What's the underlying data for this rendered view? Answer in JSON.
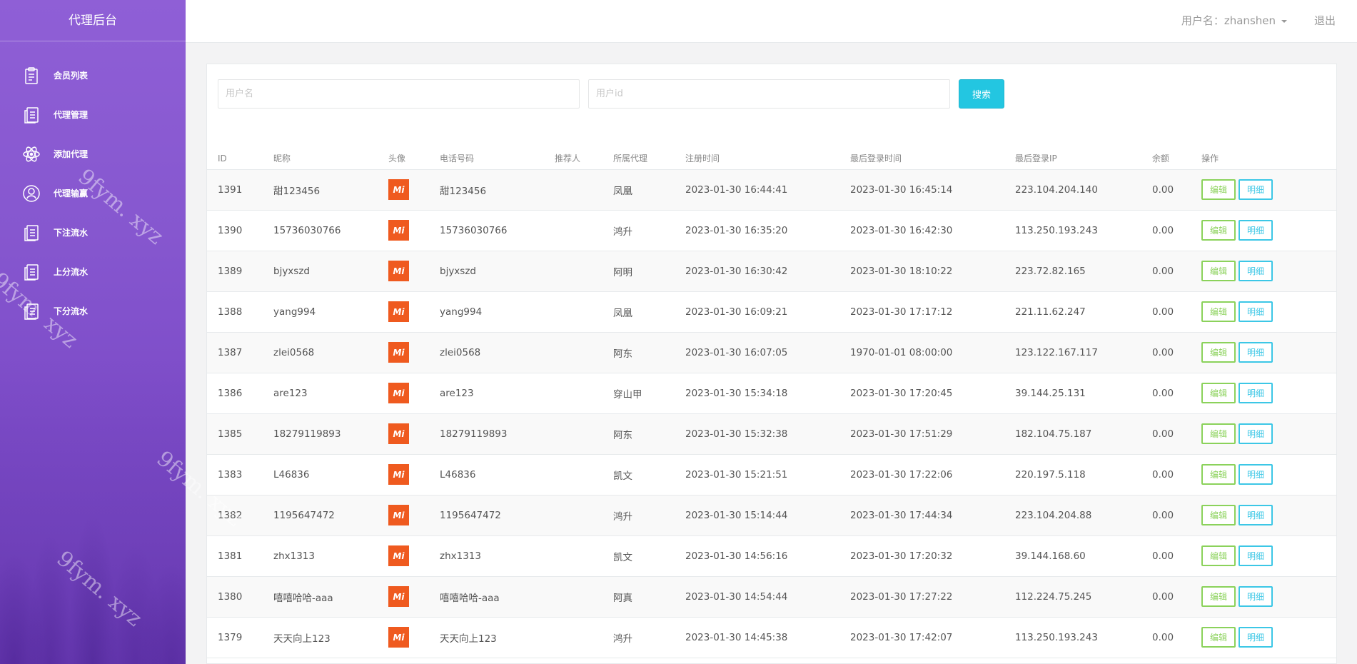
{
  "app": {
    "title": "代理后台"
  },
  "sidebar": {
    "items": [
      {
        "label": "会员列表",
        "icon": "clipboard-icon"
      },
      {
        "label": "代理管理",
        "icon": "document-icon"
      },
      {
        "label": "添加代理",
        "icon": "atom-icon"
      },
      {
        "label": "代理输赢",
        "icon": "user-circle-icon"
      },
      {
        "label": "下注流水",
        "icon": "document-icon"
      },
      {
        "label": "上分流水",
        "icon": "document-icon"
      },
      {
        "label": "下分流水",
        "icon": "document-icon"
      }
    ]
  },
  "topbar": {
    "user_label": "用户名：zhanshen",
    "logout_label": "退出"
  },
  "search": {
    "username_placeholder": "用户名",
    "userid_placeholder": "用户id",
    "button_label": "搜索"
  },
  "table": {
    "columns": [
      "ID",
      "昵称",
      "头像",
      "电话号码",
      "推荐人",
      "所属代理",
      "注册时间",
      "最后登录时间",
      "最后登录IP",
      "余额",
      "操作"
    ],
    "edit_label": "编辑",
    "detail_label": "明细",
    "avatar_text": "Mi",
    "rows": [
      {
        "id": "1391",
        "nickname": "甜123456",
        "phone": "甜123456",
        "referrer": "",
        "agent": "凤凰",
        "register": "2023-01-30 16:44:41",
        "last_login": "2023-01-30 16:45:14",
        "ip": "223.104.204.140",
        "balance": "0.00"
      },
      {
        "id": "1390",
        "nickname": "15736030766",
        "phone": "15736030766",
        "referrer": "",
        "agent": "鸿升",
        "register": "2023-01-30 16:35:20",
        "last_login": "2023-01-30 16:42:30",
        "ip": "113.250.193.243",
        "balance": "0.00"
      },
      {
        "id": "1389",
        "nickname": "bjyxszd",
        "phone": "bjyxszd",
        "referrer": "",
        "agent": "阿明",
        "register": "2023-01-30 16:30:42",
        "last_login": "2023-01-30 18:10:22",
        "ip": "223.72.82.165",
        "balance": "0.00"
      },
      {
        "id": "1388",
        "nickname": "yang994",
        "phone": "yang994",
        "referrer": "",
        "agent": "凤凰",
        "register": "2023-01-30 16:09:21",
        "last_login": "2023-01-30 17:17:12",
        "ip": "221.11.62.247",
        "balance": "0.00"
      },
      {
        "id": "1387",
        "nickname": "zlei0568",
        "phone": "zlei0568",
        "referrer": "",
        "agent": "阿东",
        "register": "2023-01-30 16:07:05",
        "last_login": "1970-01-01 08:00:00",
        "ip": "123.122.167.117",
        "balance": "0.00"
      },
      {
        "id": "1386",
        "nickname": "are123",
        "phone": "are123",
        "referrer": "",
        "agent": "穿山甲",
        "register": "2023-01-30 15:34:18",
        "last_login": "2023-01-30 17:20:45",
        "ip": "39.144.25.131",
        "balance": "0.00"
      },
      {
        "id": "1385",
        "nickname": "18279119893",
        "phone": "18279119893",
        "referrer": "",
        "agent": "阿东",
        "register": "2023-01-30 15:32:38",
        "last_login": "2023-01-30 17:51:29",
        "ip": "182.104.75.187",
        "balance": "0.00"
      },
      {
        "id": "1383",
        "nickname": "L46836",
        "phone": "L46836",
        "referrer": "",
        "agent": "凯文",
        "register": "2023-01-30 15:21:51",
        "last_login": "2023-01-30 17:22:06",
        "ip": "220.197.5.118",
        "balance": "0.00"
      },
      {
        "id": "1382",
        "nickname": "1195647472",
        "phone": "1195647472",
        "referrer": "",
        "agent": "鸿升",
        "register": "2023-01-30 15:14:44",
        "last_login": "2023-01-30 17:44:34",
        "ip": "223.104.204.88",
        "balance": "0.00"
      },
      {
        "id": "1381",
        "nickname": "zhx1313",
        "phone": "zhx1313",
        "referrer": "",
        "agent": "凯文",
        "register": "2023-01-30 14:56:16",
        "last_login": "2023-01-30 17:20:32",
        "ip": "39.144.168.60",
        "balance": "0.00"
      },
      {
        "id": "1380",
        "nickname": "嘻嘻哈哈-aaa",
        "phone": "嘻嘻哈哈-aaa",
        "referrer": "",
        "agent": "阿真",
        "register": "2023-01-30 14:54:44",
        "last_login": "2023-01-30 17:27:22",
        "ip": "112.224.75.245",
        "balance": "0.00"
      },
      {
        "id": "1379",
        "nickname": "天天向上123",
        "phone": "天天向上123",
        "referrer": "",
        "agent": "鸿升",
        "register": "2023-01-30 14:45:38",
        "last_login": "2023-01-30 17:42:07",
        "ip": "113.250.193.243",
        "balance": "0.00"
      }
    ]
  },
  "watermark": {
    "text": "9fym. xyz"
  }
}
